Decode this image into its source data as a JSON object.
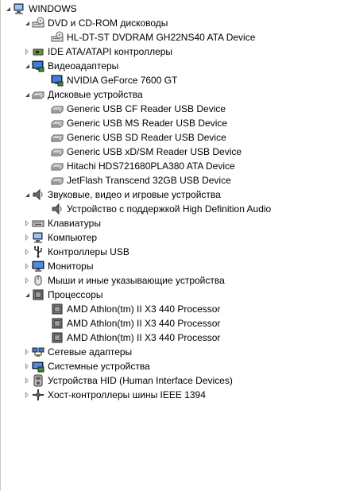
{
  "tree": {
    "root": {
      "label": "WINDOWS",
      "icon": "computer-icon"
    },
    "categories": [
      {
        "label": "DVD и CD-ROM дисководы",
        "icon": "dvd-drive-icon",
        "expanded": true,
        "children": [
          {
            "label": "HL-DT-ST DVDRAM GH22NS40 ATA Device",
            "icon": "dvd-drive-icon"
          }
        ]
      },
      {
        "label": "IDE ATA/ATAPI контроллеры",
        "icon": "ide-controller-icon",
        "expanded": false,
        "children": []
      },
      {
        "label": "Видеоадаптеры",
        "icon": "display-adapter-icon",
        "expanded": true,
        "children": [
          {
            "label": "NVIDIA GeForce 7600 GT",
            "icon": "display-adapter-icon"
          }
        ]
      },
      {
        "label": "Дисковые устройства",
        "icon": "disk-drive-icon",
        "expanded": true,
        "children": [
          {
            "label": "Generic USB CF Reader USB Device",
            "icon": "disk-drive-icon"
          },
          {
            "label": "Generic USB MS Reader USB Device",
            "icon": "disk-drive-icon"
          },
          {
            "label": "Generic USB SD Reader USB Device",
            "icon": "disk-drive-icon"
          },
          {
            "label": "Generic USB xD/SM Reader USB Device",
            "icon": "disk-drive-icon"
          },
          {
            "label": "Hitachi HDS721680PLA380 ATA Device",
            "icon": "disk-drive-icon"
          },
          {
            "label": "JetFlash Transcend 32GB USB Device",
            "icon": "disk-drive-icon"
          }
        ]
      },
      {
        "label": "Звуковые, видео и игровые устройства",
        "icon": "speaker-icon",
        "expanded": true,
        "children": [
          {
            "label": "Устройство с поддержкой High Definition Audio",
            "icon": "speaker-icon"
          }
        ]
      },
      {
        "label": "Клавиатуры",
        "icon": "keyboard-icon",
        "expanded": false,
        "children": []
      },
      {
        "label": "Компьютер",
        "icon": "computer-icon",
        "expanded": false,
        "children": []
      },
      {
        "label": "Контроллеры USB",
        "icon": "usb-controller-icon",
        "expanded": false,
        "children": []
      },
      {
        "label": "Мониторы",
        "icon": "monitor-icon",
        "expanded": false,
        "children": []
      },
      {
        "label": "Мыши и иные указывающие устройства",
        "icon": "mouse-icon",
        "expanded": false,
        "children": []
      },
      {
        "label": "Процессоры",
        "icon": "processor-icon",
        "expanded": true,
        "children": [
          {
            "label": "AMD Athlon(tm) II X3 440 Processor",
            "icon": "processor-icon"
          },
          {
            "label": "AMD Athlon(tm) II X3 440 Processor",
            "icon": "processor-icon"
          },
          {
            "label": "AMD Athlon(tm) II X3 440 Processor",
            "icon": "processor-icon"
          }
        ]
      },
      {
        "label": "Сетевые адаптеры",
        "icon": "network-adapter-icon",
        "expanded": false,
        "children": []
      },
      {
        "label": "Системные устройства",
        "icon": "system-device-icon",
        "expanded": false,
        "children": []
      },
      {
        "label": "Устройства HID (Human Interface Devices)",
        "icon": "hid-icon",
        "expanded": false,
        "children": []
      },
      {
        "label": "Хост-контроллеры шины IEEE 1394",
        "icon": "ieee1394-icon",
        "expanded": false,
        "children": []
      }
    ]
  }
}
